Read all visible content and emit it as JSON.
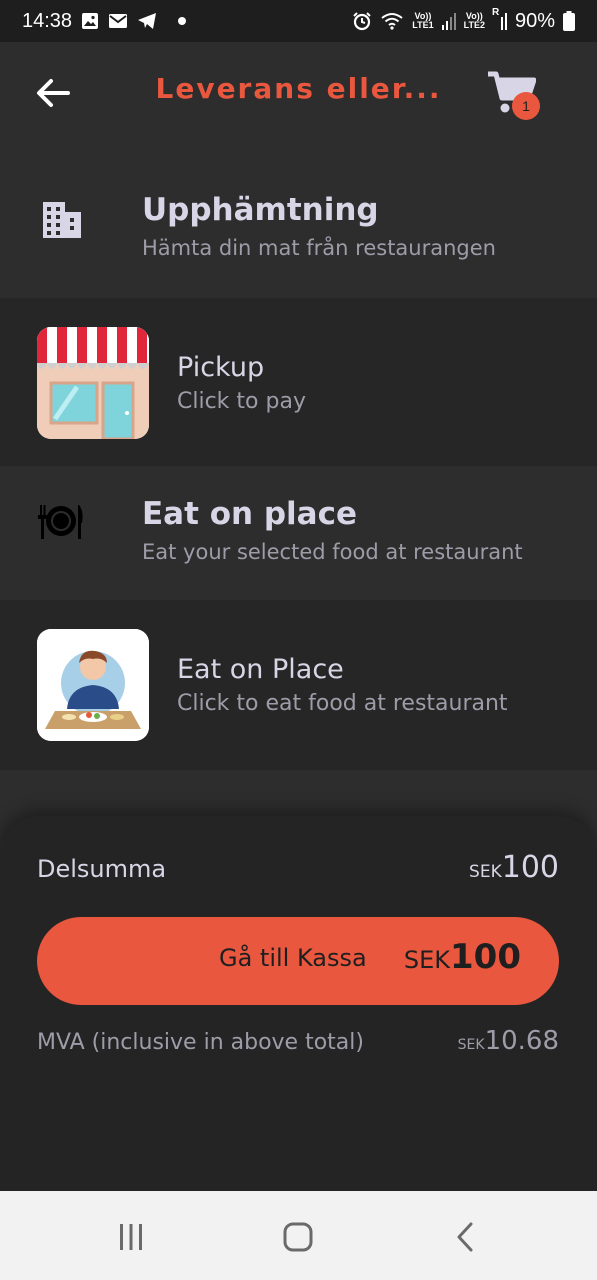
{
  "status_bar": {
    "time": "14:38",
    "sim1_top": "Vo))",
    "sim1_bottom": "LTE1",
    "sim2_top": "Vo))",
    "sim2_bottom": "LTE2",
    "roaming": "R",
    "battery": "90%",
    "icons": [
      "gallery-icon",
      "mail-icon",
      "telegram-icon",
      "dot-icon",
      "alarm-icon",
      "wifi-icon",
      "signal-icon",
      "battery-icon"
    ]
  },
  "header": {
    "title": "Leverans eller...",
    "cart_count": "1",
    "accent_color": "#e9573f"
  },
  "options": [
    {
      "title": "Upphämtning",
      "subtitle": "Hämta din mat från restaurangen",
      "icon": "building-icon"
    },
    {
      "title": "Pickup",
      "subtitle": "Click to pay",
      "icon": "storefront-image"
    },
    {
      "title": "Eat on place",
      "subtitle": "Eat your selected food at restaurant",
      "icon": "dining-icon"
    },
    {
      "title": "Eat on Place",
      "subtitle": "Click to eat food at restaurant",
      "icon": "person-eating-image"
    }
  ],
  "summary": {
    "subtotal_label": "Delsumma",
    "subtotal_currency": "SEK",
    "subtotal_amount": "100",
    "checkout_label": "Gå till Kassa",
    "checkout_currency": "SEK",
    "checkout_amount": "100",
    "vat_label": "MVA (inclusive in above total)",
    "vat_currency": "SEK",
    "vat_amount": "10.68"
  },
  "nav_bar": {
    "icons": [
      "recent-apps-icon",
      "home-icon",
      "back-nav-icon"
    ]
  }
}
